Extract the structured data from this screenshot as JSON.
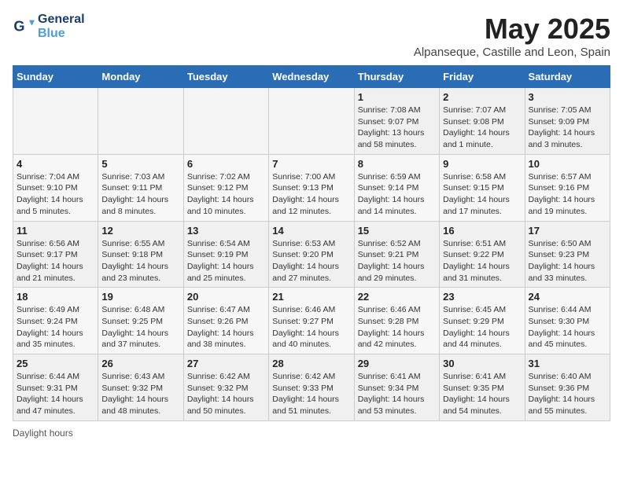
{
  "logo": {
    "line1": "General",
    "line2": "Blue"
  },
  "title": "May 2025",
  "location": "Alpanseque, Castille and Leon, Spain",
  "weekdays": [
    "Sunday",
    "Monday",
    "Tuesday",
    "Wednesday",
    "Thursday",
    "Friday",
    "Saturday"
  ],
  "weeks": [
    [
      {
        "day": "",
        "info": "",
        "empty": true
      },
      {
        "day": "",
        "info": "",
        "empty": true
      },
      {
        "day": "",
        "info": "",
        "empty": true
      },
      {
        "day": "",
        "info": "",
        "empty": true
      },
      {
        "day": "1",
        "info": "Sunrise: 7:08 AM\nSunset: 9:07 PM\nDaylight: 13 hours\nand 58 minutes."
      },
      {
        "day": "2",
        "info": "Sunrise: 7:07 AM\nSunset: 9:08 PM\nDaylight: 14 hours\nand 1 minute."
      },
      {
        "day": "3",
        "info": "Sunrise: 7:05 AM\nSunset: 9:09 PM\nDaylight: 14 hours\nand 3 minutes."
      }
    ],
    [
      {
        "day": "4",
        "info": "Sunrise: 7:04 AM\nSunset: 9:10 PM\nDaylight: 14 hours\nand 5 minutes."
      },
      {
        "day": "5",
        "info": "Sunrise: 7:03 AM\nSunset: 9:11 PM\nDaylight: 14 hours\nand 8 minutes."
      },
      {
        "day": "6",
        "info": "Sunrise: 7:02 AM\nSunset: 9:12 PM\nDaylight: 14 hours\nand 10 minutes."
      },
      {
        "day": "7",
        "info": "Sunrise: 7:00 AM\nSunset: 9:13 PM\nDaylight: 14 hours\nand 12 minutes."
      },
      {
        "day": "8",
        "info": "Sunrise: 6:59 AM\nSunset: 9:14 PM\nDaylight: 14 hours\nand 14 minutes."
      },
      {
        "day": "9",
        "info": "Sunrise: 6:58 AM\nSunset: 9:15 PM\nDaylight: 14 hours\nand 17 minutes."
      },
      {
        "day": "10",
        "info": "Sunrise: 6:57 AM\nSunset: 9:16 PM\nDaylight: 14 hours\nand 19 minutes."
      }
    ],
    [
      {
        "day": "11",
        "info": "Sunrise: 6:56 AM\nSunset: 9:17 PM\nDaylight: 14 hours\nand 21 minutes."
      },
      {
        "day": "12",
        "info": "Sunrise: 6:55 AM\nSunset: 9:18 PM\nDaylight: 14 hours\nand 23 minutes."
      },
      {
        "day": "13",
        "info": "Sunrise: 6:54 AM\nSunset: 9:19 PM\nDaylight: 14 hours\nand 25 minutes."
      },
      {
        "day": "14",
        "info": "Sunrise: 6:53 AM\nSunset: 9:20 PM\nDaylight: 14 hours\nand 27 minutes."
      },
      {
        "day": "15",
        "info": "Sunrise: 6:52 AM\nSunset: 9:21 PM\nDaylight: 14 hours\nand 29 minutes."
      },
      {
        "day": "16",
        "info": "Sunrise: 6:51 AM\nSunset: 9:22 PM\nDaylight: 14 hours\nand 31 minutes."
      },
      {
        "day": "17",
        "info": "Sunrise: 6:50 AM\nSunset: 9:23 PM\nDaylight: 14 hours\nand 33 minutes."
      }
    ],
    [
      {
        "day": "18",
        "info": "Sunrise: 6:49 AM\nSunset: 9:24 PM\nDaylight: 14 hours\nand 35 minutes."
      },
      {
        "day": "19",
        "info": "Sunrise: 6:48 AM\nSunset: 9:25 PM\nDaylight: 14 hours\nand 37 minutes."
      },
      {
        "day": "20",
        "info": "Sunrise: 6:47 AM\nSunset: 9:26 PM\nDaylight: 14 hours\nand 38 minutes."
      },
      {
        "day": "21",
        "info": "Sunrise: 6:46 AM\nSunset: 9:27 PM\nDaylight: 14 hours\nand 40 minutes."
      },
      {
        "day": "22",
        "info": "Sunrise: 6:46 AM\nSunset: 9:28 PM\nDaylight: 14 hours\nand 42 minutes."
      },
      {
        "day": "23",
        "info": "Sunrise: 6:45 AM\nSunset: 9:29 PM\nDaylight: 14 hours\nand 44 minutes."
      },
      {
        "day": "24",
        "info": "Sunrise: 6:44 AM\nSunset: 9:30 PM\nDaylight: 14 hours\nand 45 minutes."
      }
    ],
    [
      {
        "day": "25",
        "info": "Sunrise: 6:44 AM\nSunset: 9:31 PM\nDaylight: 14 hours\nand 47 minutes."
      },
      {
        "day": "26",
        "info": "Sunrise: 6:43 AM\nSunset: 9:32 PM\nDaylight: 14 hours\nand 48 minutes."
      },
      {
        "day": "27",
        "info": "Sunrise: 6:42 AM\nSunset: 9:32 PM\nDaylight: 14 hours\nand 50 minutes."
      },
      {
        "day": "28",
        "info": "Sunrise: 6:42 AM\nSunset: 9:33 PM\nDaylight: 14 hours\nand 51 minutes."
      },
      {
        "day": "29",
        "info": "Sunrise: 6:41 AM\nSunset: 9:34 PM\nDaylight: 14 hours\nand 53 minutes."
      },
      {
        "day": "30",
        "info": "Sunrise: 6:41 AM\nSunset: 9:35 PM\nDaylight: 14 hours\nand 54 minutes."
      },
      {
        "day": "31",
        "info": "Sunrise: 6:40 AM\nSunset: 9:36 PM\nDaylight: 14 hours\nand 55 minutes."
      }
    ]
  ],
  "footer": "Daylight hours"
}
